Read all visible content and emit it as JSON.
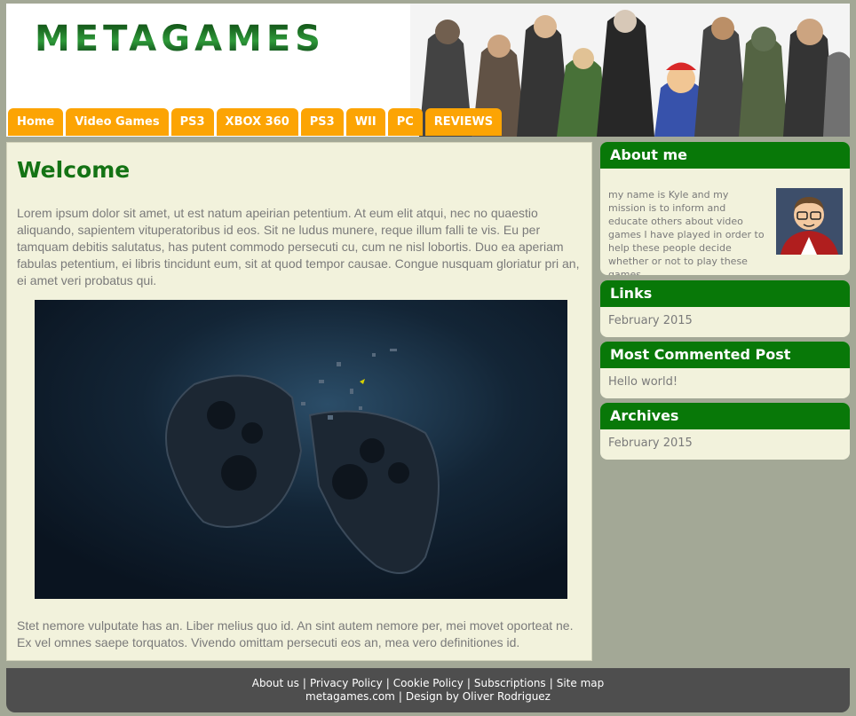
{
  "brand": {
    "logo_text": "METAGAMES"
  },
  "nav": {
    "items": [
      "Home",
      "Video Games",
      "PS3",
      "XBOX 360",
      "PS3",
      "WII",
      "PC",
      "REVIEWS"
    ]
  },
  "main": {
    "title": "Welcome",
    "paragraph_1": "Lorem ipsum dolor sit amet, ut est natum apeirian petentium. At eum elit atqui, nec no quaestio aliquando, sapientem vituperatoribus id eos. Sit ne ludus munere, reque illum falli te vis. Eu per tamquam debitis salutatus, has putent commodo persecuti cu, cum ne nisl lobortis. Duo ea aperiam fabulas petentium, ei libris tincidunt eum, sit at quod tempor causae. Congue nusquam gloriatur pri an, ei amet veri probatus qui.",
    "paragraph_2": "Stet nemore vulputate has an. Liber melius quo id. An sint autem nemore per, mei movet oporteat ne. Ex vel omnes saepe torquatos. Vivendo omittam persecuti eos an, mea vero definitiones id."
  },
  "sidebar": {
    "about": {
      "title": "About me",
      "text": "my name is Kyle and my mission is to inform and educate others about video games I have played in order to help these people decide whether or not to play these games."
    },
    "links": {
      "title": "Links",
      "item": "February 2015"
    },
    "most_commented": {
      "title": "Most Commented Post",
      "item": "Hello world!"
    },
    "archives": {
      "title": "Archives",
      "item": "February 2015"
    }
  },
  "footer": {
    "links": [
      "About us",
      "Privacy Policy",
      "Cookie Policy",
      "Subscriptions",
      "Site map"
    ],
    "site": "metagames.com",
    "credit": "Design by Oliver Rodriguez"
  },
  "colors": {
    "nav_orange": "#fca404",
    "widget_green": "#087808",
    "title_green": "#147314",
    "content_bg": "#f2f2dc",
    "footer_bg": "#4e4e4e"
  }
}
